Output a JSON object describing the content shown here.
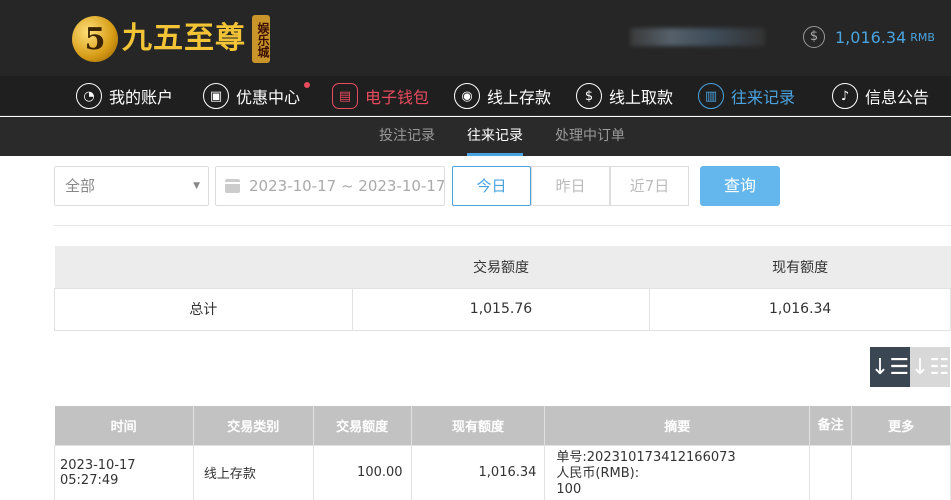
{
  "header": {
    "logo_mark": "5",
    "logo_text": "九五至尊",
    "logo_badge": "娱乐城",
    "balance": "1,016.34",
    "currency": "RMB",
    "coin_symbol": "$"
  },
  "nav": [
    {
      "label": "我的账户",
      "icon": "user-icon",
      "glyph": "◔"
    },
    {
      "label": "优惠中心",
      "icon": "gift-icon",
      "glyph": "▣"
    },
    {
      "label": "电子钱包",
      "icon": "wallet-icon",
      "glyph": "▤"
    },
    {
      "label": "线上存款",
      "icon": "deposit-icon",
      "glyph": "◉"
    },
    {
      "label": "线上取款",
      "icon": "withdraw-icon",
      "glyph": "$"
    },
    {
      "label": "往来记录",
      "icon": "records-icon",
      "glyph": "▥"
    },
    {
      "label": "信息公告",
      "icon": "bell-icon",
      "glyph": "♪"
    }
  ],
  "subnav": [
    {
      "label": "投注记录"
    },
    {
      "label": "往来记录"
    },
    {
      "label": "处理中订单"
    }
  ],
  "filters": {
    "type_value": "全部",
    "date_range": "2023-10-17 ~ 2023-10-17",
    "ranges": [
      "今日",
      "昨日",
      "近7日"
    ],
    "query": "查询"
  },
  "summary": {
    "headers": [
      "",
      "交易额度",
      "现有额度"
    ],
    "row": [
      "总计",
      "1,015.76",
      "1,016.34"
    ]
  },
  "sort": {
    "desc": "↓☰",
    "asc": "↓☷"
  },
  "records": {
    "headers": [
      "时间",
      "交易类别",
      "交易额度",
      "现有额度",
      "摘要",
      "备注",
      "更多"
    ],
    "rows": [
      {
        "time": "2023-10-17 05:27:49",
        "type": "线上存款",
        "amount": "100.00",
        "balance": "1,016.34",
        "summary_1": "单号:202310173412166073",
        "summary_2": "人民币(RMB):",
        "summary_3": "100",
        "note": "",
        "more": ""
      }
    ]
  },
  "colors": {
    "accent": "#4aa3df",
    "wallet_red": "#e84b5d",
    "header_bg": "#262626"
  }
}
